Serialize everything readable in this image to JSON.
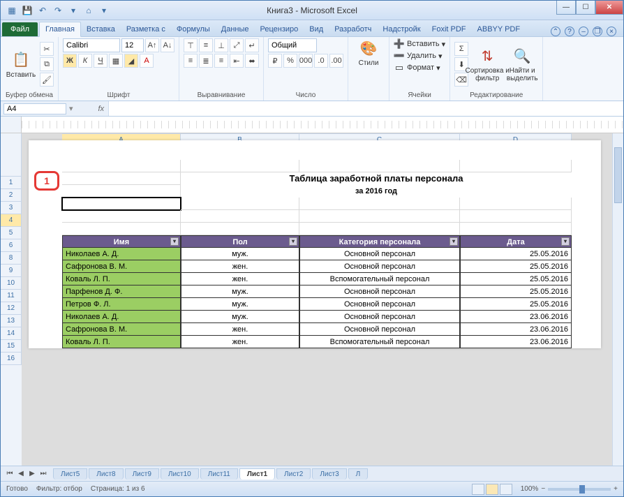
{
  "title": "Книга3 - Microsoft Excel",
  "tabs": {
    "file": "Файл",
    "list": [
      "Главная",
      "Вставка",
      "Разметка с",
      "Формулы",
      "Данные",
      "Рецензиро",
      "Вид",
      "Разработч",
      "Надстройк",
      "Foxit PDF",
      "ABBYY PDF"
    ],
    "activeIndex": 0
  },
  "ribbon": {
    "clipboard": {
      "paste": "Вставить",
      "label": "Буфер обмена"
    },
    "font": {
      "name": "Calibri",
      "size": "12",
      "label": "Шрифт"
    },
    "alignment": {
      "label": "Выравнивание"
    },
    "number": {
      "format": "Общий",
      "label": "Число"
    },
    "styles": {
      "btn": "Стили",
      "label": ""
    },
    "cells": {
      "insert": "Вставить",
      "delete": "Удалить",
      "format": "Формат",
      "label": "Ячейки"
    },
    "editing": {
      "sort": "Сортировка и фильтр",
      "find": "Найти и выделить",
      "label": "Редактирование"
    }
  },
  "nameBox": "A4",
  "fx": "fx",
  "columns": [
    "A",
    "B",
    "C",
    "D"
  ],
  "pageMarker": "1",
  "sheetTitle": "Таблица заработной платы персонала",
  "sheetSubtitle": "за 2016 год",
  "headers": [
    "Имя",
    "Пол",
    "Категория персонала",
    "Дата"
  ],
  "rows": [
    {
      "n": "Николаев А. Д.",
      "g": "муж.",
      "c": "Основной персонал",
      "d": "25.05.2016"
    },
    {
      "n": "Сафронова В. М.",
      "g": "жен.",
      "c": "Основной персонал",
      "d": "25.05.2016"
    },
    {
      "n": "Коваль Л. П.",
      "g": "жен.",
      "c": "Вспомогательный персонал",
      "d": "25.05.2016"
    },
    {
      "n": "Парфенов Д. Ф.",
      "g": "муж.",
      "c": "Основной персонал",
      "d": "25.05.2016"
    },
    {
      "n": "Петров Ф. Л.",
      "g": "муж.",
      "c": "Основной персонал",
      "d": "25.05.2016"
    },
    {
      "n": "Николаев А. Д.",
      "g": "муж.",
      "c": "Основной персонал",
      "d": "23.06.2016"
    },
    {
      "n": "Сафронова В. М.",
      "g": "жен.",
      "c": "Основной персонал",
      "d": "23.06.2016"
    },
    {
      "n": "Коваль Л. П.",
      "g": "жен.",
      "c": "Вспомогательный персонал",
      "d": "23.06.2016"
    }
  ],
  "rowNumbers": [
    "1",
    "2",
    "3",
    "4",
    "5",
    "6",
    "8",
    "9",
    "10",
    "11",
    "12",
    "13",
    "14",
    "15",
    "16"
  ],
  "selectedRowIndex": 3,
  "sheetTabs": [
    "Лист5",
    "Лист8",
    "Лист9",
    "Лист10",
    "Лист11",
    "Лист1",
    "Лист2",
    "Лист3",
    "Л"
  ],
  "activeSheetTab": 5,
  "status": {
    "ready": "Готово",
    "filter": "Фильтр: отбор",
    "page": "Страница: 1 из 6",
    "zoom": "100%"
  }
}
